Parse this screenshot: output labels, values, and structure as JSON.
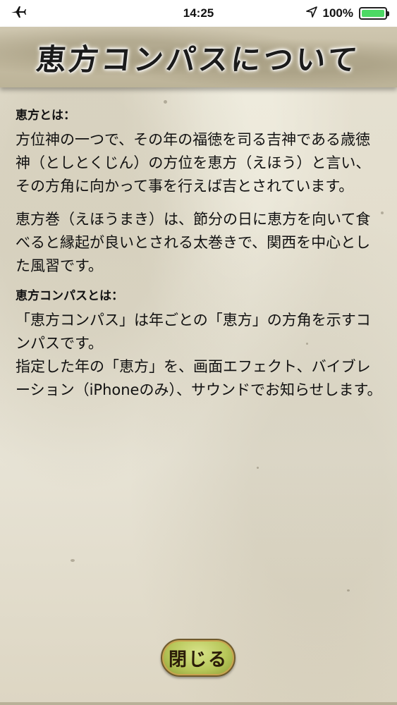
{
  "status_bar": {
    "time": "14:25",
    "battery_percent_text": "100%",
    "battery_level": 1.0,
    "airplane_icon": "airplane-icon",
    "location_icon": "location-arrow-icon",
    "battery_icon": "battery-icon",
    "battery_color": "#4cd964"
  },
  "header": {
    "title": "恵方コンパスについて"
  },
  "content": {
    "section1_heading": "恵方とは：",
    "section1_para1": "方位神の一つで、その年の福徳を司る吉神である歳徳神（としとくじん）の方位を恵方（えほう）と言い、その方角に向かって事を行えば吉とされています。",
    "section1_para2": "恵方巻（えほうまき）は、節分の日に恵方を向いて食べると縁起が良いとされる太巻きで、関西を中心とした風習です。",
    "section2_heading": "恵方コンパスとは：",
    "section2_para1": "「恵方コンパス」は年ごとの「恵方」の方角を示すコンパスです。",
    "section2_para2": "指定した年の「恵方」を、画面エフェクト、バイブレーション（iPhoneのみ）、サウンドでお知らせします。"
  },
  "footer": {
    "close_label": "閉じる",
    "close_button_color": "#b7c75a"
  }
}
